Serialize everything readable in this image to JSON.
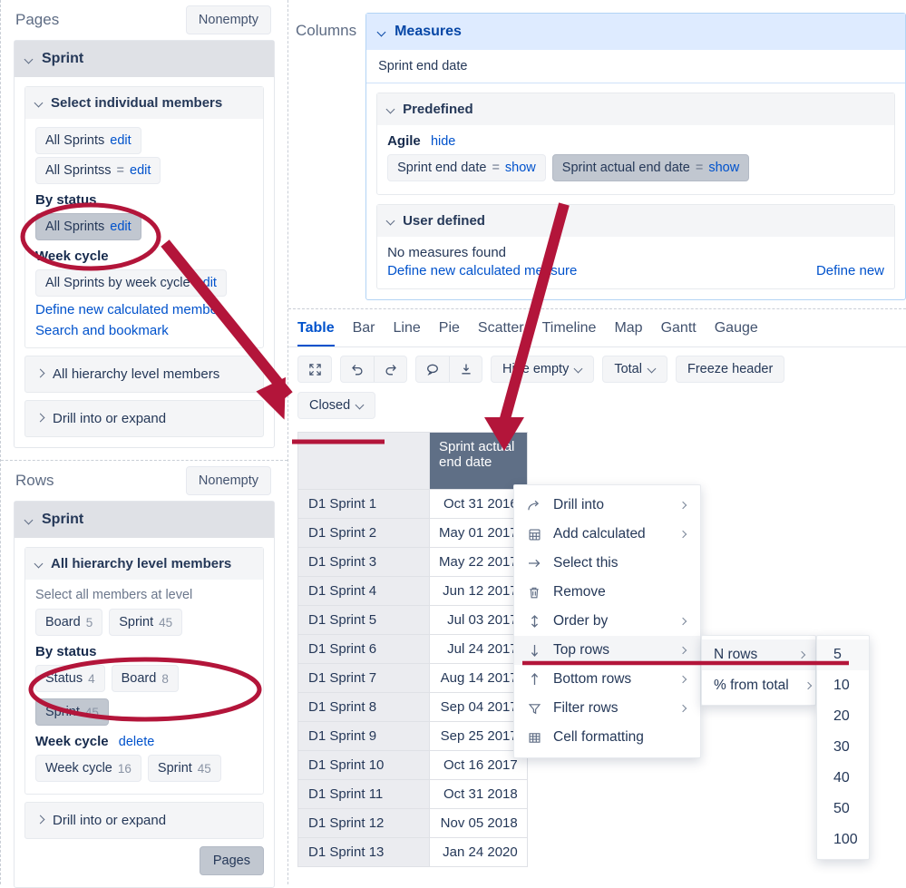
{
  "pages_axis": {
    "title": "Pages",
    "nonempty_label": "Nonempty",
    "dimension": "Sprint",
    "section_individual": "Select individual members",
    "chip_all_sprints": "All Sprints",
    "edit_label": "edit",
    "chip_all_sprintss": "All Sprintss",
    "eq_label": "=",
    "group_by_status": "By status",
    "chip_by_status_selected": "All Sprints",
    "group_week_cycle": "Week cycle",
    "chip_week_cycle": "All Sprints by week cycle",
    "link_define_new_member": "Define new calculated member",
    "link_search_bookmark": "Search and bookmark",
    "collapsed_all_hierarchy": "All hierarchy level members",
    "collapsed_drill": "Drill into or expand"
  },
  "rows_axis": {
    "title": "Rows",
    "nonempty_label": "Nonempty",
    "dimension": "Sprint",
    "section_all_hierarchy": "All hierarchy level members",
    "select_all_caption": "Select all members at level",
    "level_chips": [
      {
        "label": "Board",
        "count": "5",
        "selected": false
      },
      {
        "label": "Sprint",
        "count": "45",
        "selected": false
      }
    ],
    "group_by_status": "By status",
    "by_status_chips": [
      {
        "label": "Status",
        "count": "4",
        "selected": false
      },
      {
        "label": "Board",
        "count": "8",
        "selected": false
      },
      {
        "label": "Sprint",
        "count": "45",
        "selected": true
      }
    ],
    "group_week_cycle": "Week cycle",
    "week_cycle_delete": "delete",
    "week_cycle_chips": [
      {
        "label": "Week cycle",
        "count": "16",
        "selected": false
      },
      {
        "label": "Sprint",
        "count": "45",
        "selected": false
      }
    ],
    "collapsed_drill": "Drill into or expand",
    "pages_button": "Pages"
  },
  "columns_axis": {
    "label": "Columns",
    "measures_title": "Measures",
    "measures_subtitle": "Sprint end date",
    "predefined_title": "Predefined",
    "agile_group": "Agile",
    "agile_hide": "hide",
    "agile_chips": [
      {
        "label": "Sprint end date",
        "eq": "=",
        "action": "show",
        "selected": false
      },
      {
        "label": "Sprint actual end date",
        "eq": "=",
        "action": "show",
        "selected": true
      }
    ],
    "user_defined_title": "User defined",
    "no_measures": "No measures found",
    "link_define_new_measure": "Define new calculated measure",
    "link_define_new_right": "Define new"
  },
  "viz": {
    "tabs": [
      {
        "label": "Table",
        "active": true
      },
      {
        "label": "Bar",
        "active": false
      },
      {
        "label": "Line",
        "active": false
      },
      {
        "label": "Pie",
        "active": false
      },
      {
        "label": "Scatter",
        "active": false
      },
      {
        "label": "Timeline",
        "active": false
      },
      {
        "label": "Map",
        "active": false
      },
      {
        "label": "Gantt",
        "active": false
      },
      {
        "label": "Gauge",
        "active": false
      }
    ],
    "toolbar_icons": [
      "expand-icon",
      "undo-icon",
      "redo-icon",
      "comment-icon",
      "download-icon"
    ],
    "hide_empty": "Hide empty",
    "total": "Total",
    "freeze_header": "Freeze header",
    "filter_chip": "Closed"
  },
  "table": {
    "corner": "",
    "measure_header": "Sprint actual end date",
    "rows": [
      {
        "label": "D1 Sprint 1",
        "value": "Oct 31 2016"
      },
      {
        "label": "D1 Sprint 2",
        "value": "May 01 2017"
      },
      {
        "label": "D1 Sprint 3",
        "value": "May 22 2017"
      },
      {
        "label": "D1 Sprint 4",
        "value": "Jun 12 2017"
      },
      {
        "label": "D1 Sprint 5",
        "value": "Jul 03 2017"
      },
      {
        "label": "D1 Sprint 6",
        "value": "Jul 24 2017"
      },
      {
        "label": "D1 Sprint 7",
        "value": "Aug 14 2017"
      },
      {
        "label": "D1 Sprint 8",
        "value": "Sep 04 2017"
      },
      {
        "label": "D1 Sprint 9",
        "value": "Sep 25 2017"
      },
      {
        "label": "D1 Sprint 10",
        "value": "Oct 16 2017"
      },
      {
        "label": "D1 Sprint 11",
        "value": "Oct 31 2018"
      },
      {
        "label": "D1 Sprint 12",
        "value": "Nov 05 2018"
      },
      {
        "label": "D1 Sprint 13",
        "value": "Jan 24 2020"
      }
    ]
  },
  "context_menu": {
    "items": [
      {
        "label": "Drill into",
        "icon": "drill-into-icon",
        "submenu": true,
        "highlight": false
      },
      {
        "label": "Add calculated",
        "icon": "calculator-icon",
        "submenu": true,
        "highlight": false
      },
      {
        "label": "Select this",
        "icon": "arrow-right-icon",
        "submenu": false,
        "highlight": false
      },
      {
        "label": "Remove",
        "icon": "trash-icon",
        "submenu": false,
        "highlight": false
      },
      {
        "label": "Order by",
        "icon": "sort-updown-icon",
        "submenu": true,
        "highlight": false
      },
      {
        "label": "Top rows",
        "icon": "arrow-down-icon",
        "submenu": true,
        "highlight": true
      },
      {
        "label": "Bottom rows",
        "icon": "arrow-up-icon",
        "submenu": true,
        "highlight": false
      },
      {
        "label": "Filter rows",
        "icon": "funnel-icon",
        "submenu": false,
        "highlight": false
      },
      {
        "label": "Cell formatting",
        "icon": "grid-icon",
        "submenu": false,
        "highlight": false
      }
    ],
    "submenu": [
      {
        "label": "N rows",
        "submenu": true,
        "highlight": true
      },
      {
        "label": "% from total",
        "submenu": true,
        "highlight": false
      }
    ],
    "numbers": [
      {
        "label": "5",
        "highlight": true
      },
      {
        "label": "10",
        "highlight": false
      },
      {
        "label": "20",
        "highlight": false
      },
      {
        "label": "30",
        "highlight": false
      },
      {
        "label": "40",
        "highlight": false
      },
      {
        "label": "50",
        "highlight": false
      },
      {
        "label": "100",
        "highlight": false
      }
    ]
  },
  "colors": {
    "accent_blue": "#0052cc",
    "annotation_red": "#b3153a",
    "measure_header_bg": "#5f6f86",
    "selected_chip_bg": "#c1c7d0",
    "measures_panel_bg": "#deebff"
  }
}
